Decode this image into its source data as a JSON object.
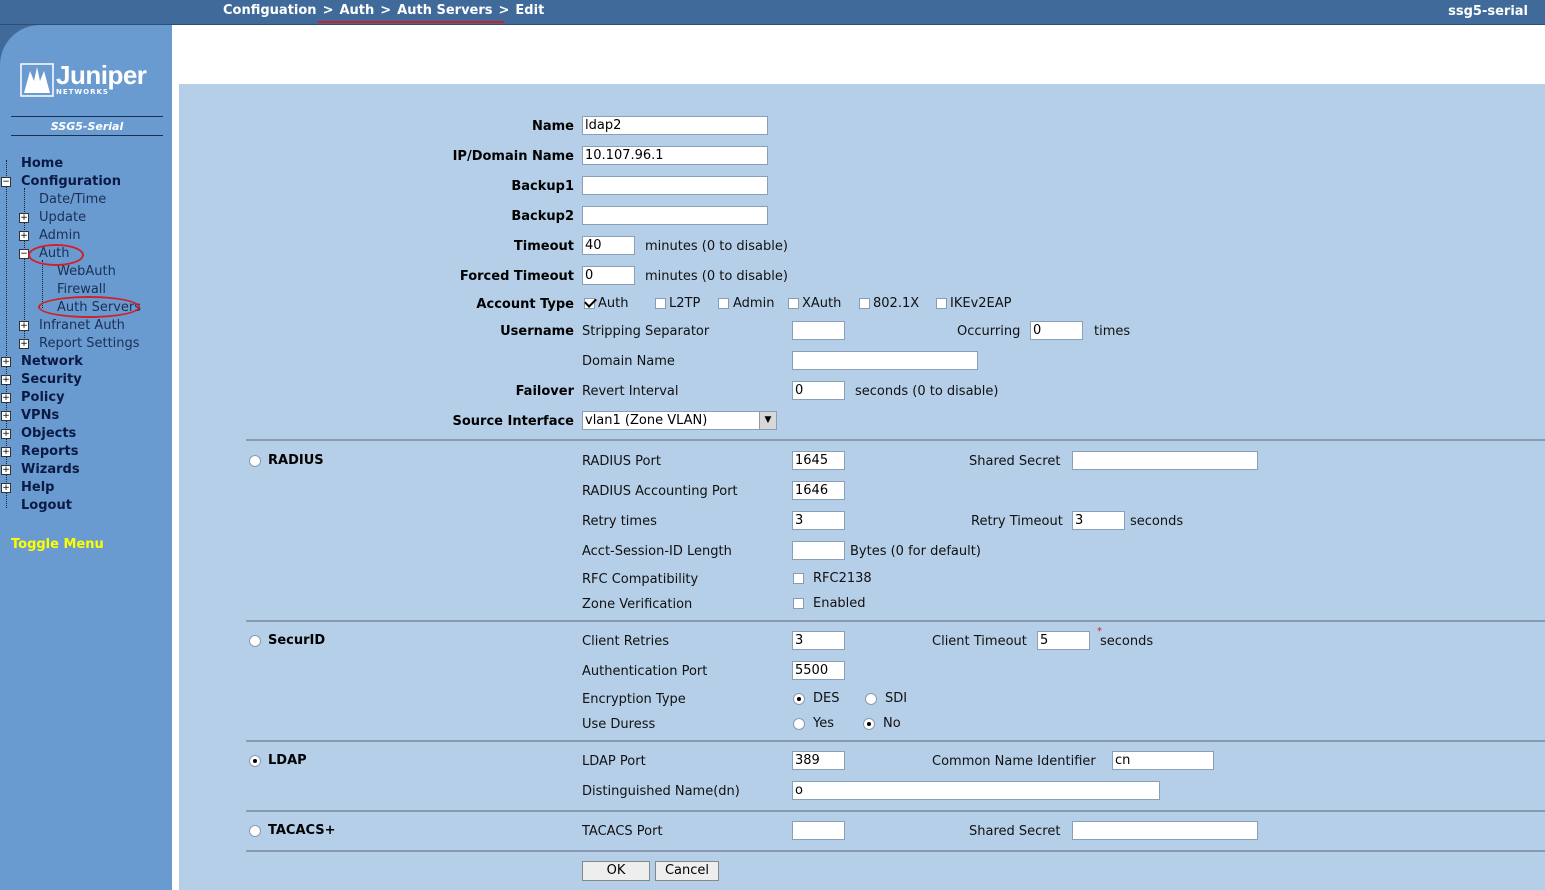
{
  "header": {
    "breadcrumb": [
      "Configuation",
      "Auth",
      "Auth Servers",
      "Edit"
    ],
    "breadcrumb_sep": ">",
    "device": "ssg5-serial"
  },
  "sidebar": {
    "logo": "Juniper",
    "logo_sub": "NETWORKS",
    "model": "SSG5-Serial",
    "items": [
      {
        "label": "Home",
        "level": 0,
        "expander": "none"
      },
      {
        "label": "Configuration",
        "level": 0,
        "expander": "minus"
      },
      {
        "label": "Date/Time",
        "level": 1,
        "expander": "none"
      },
      {
        "label": "Update",
        "level": 1,
        "expander": "plus"
      },
      {
        "label": "Admin",
        "level": 1,
        "expander": "plus"
      },
      {
        "label": "Auth",
        "level": 1,
        "expander": "minus"
      },
      {
        "label": "WebAuth",
        "level": 2,
        "expander": "none"
      },
      {
        "label": "Firewall",
        "level": 2,
        "expander": "none"
      },
      {
        "label": "Auth Servers",
        "level": 2,
        "expander": "none"
      },
      {
        "label": "Infranet Auth",
        "level": 1,
        "expander": "plus"
      },
      {
        "label": "Report Settings",
        "level": 1,
        "expander": "plus"
      },
      {
        "label": "Network",
        "level": 0,
        "expander": "plus"
      },
      {
        "label": "Security",
        "level": 0,
        "expander": "plus"
      },
      {
        "label": "Policy",
        "level": 0,
        "expander": "plus"
      },
      {
        "label": "VPNs",
        "level": 0,
        "expander": "plus"
      },
      {
        "label": "Objects",
        "level": 0,
        "expander": "plus"
      },
      {
        "label": "Reports",
        "level": 0,
        "expander": "plus"
      },
      {
        "label": "Wizards",
        "level": 0,
        "expander": "plus"
      },
      {
        "label": "Help",
        "level": 0,
        "expander": "plus"
      },
      {
        "label": "Logout",
        "level": 0,
        "expander": "none"
      }
    ],
    "toggle_menu": "Toggle Menu",
    "annotation_color": "#d02028"
  },
  "form": {
    "name": {
      "label": "Name",
      "value": "ldap2"
    },
    "ip_domain": {
      "label": "IP/Domain Name",
      "value": "10.107.96.1"
    },
    "backup1": {
      "label": "Backup1",
      "value": ""
    },
    "backup2": {
      "label": "Backup2",
      "value": ""
    },
    "timeout": {
      "label": "Timeout",
      "value": "40",
      "unit": "minutes (0 to disable)"
    },
    "forced_timeout": {
      "label": "Forced Timeout",
      "value": "0",
      "unit": "minutes (0 to disable)"
    },
    "account_type": {
      "label": "Account Type",
      "options": [
        {
          "label": "Auth",
          "checked": true
        },
        {
          "label": "L2TP",
          "checked": false
        },
        {
          "label": "Admin",
          "checked": false
        },
        {
          "label": "XAuth",
          "checked": false
        },
        {
          "label": "802.1X",
          "checked": false
        },
        {
          "label": "IKEv2EAP",
          "checked": false
        }
      ]
    },
    "username": {
      "label": "Username",
      "stripping_separator": {
        "label": "Stripping Separator",
        "value": ""
      },
      "occurring": {
        "label": "Occurring",
        "value": "0",
        "unit": "times"
      },
      "domain_name": {
        "label": "Domain Name",
        "value": ""
      }
    },
    "failover": {
      "label": "Failover",
      "revert_interval": {
        "label": "Revert Interval",
        "value": "0",
        "unit": "seconds (0 to disable)"
      }
    },
    "source_interface": {
      "label": "Source Interface",
      "value": "vlan1 (Zone VLAN)"
    },
    "radius": {
      "label": "RADIUS",
      "selected": false,
      "port": {
        "label": "RADIUS Port",
        "value": "1645"
      },
      "shared_secret": {
        "label": "Shared Secret",
        "value": ""
      },
      "accounting_port": {
        "label": "RADIUS Accounting Port",
        "value": "1646"
      },
      "retry_times": {
        "label": "Retry times",
        "value": "3"
      },
      "retry_timeout": {
        "label": "Retry Timeout",
        "value": "3",
        "unit": "seconds"
      },
      "acct_session": {
        "label": "Acct-Session-ID Length",
        "value": "",
        "unit": "Bytes (0 for default)"
      },
      "rfc": {
        "label": "RFC Compatibility",
        "option": "RFC2138",
        "checked": false
      },
      "zone_verification": {
        "label": "Zone Verification",
        "option": "Enabled",
        "checked": false
      }
    },
    "securid": {
      "label": "SecurID",
      "selected": false,
      "client_retries": {
        "label": "Client Retries",
        "value": "3"
      },
      "client_timeout": {
        "label": "Client Timeout",
        "value": "5",
        "unit": "seconds"
      },
      "auth_port": {
        "label": "Authentication Port",
        "value": "5500"
      },
      "encryption_type": {
        "label": "Encryption Type",
        "options": [
          "DES",
          "SDI"
        ],
        "selected": "DES"
      },
      "use_duress": {
        "label": "Use Duress",
        "options": [
          "Yes",
          "No"
        ],
        "selected": "No"
      }
    },
    "ldap": {
      "label": "LDAP",
      "selected": true,
      "port": {
        "label": "LDAP Port",
        "value": "389"
      },
      "cn_identifier": {
        "label": "Common Name Identifier",
        "value": "cn"
      },
      "dn": {
        "label": "Distinguished Name(dn)",
        "value": "o"
      }
    },
    "tacacs": {
      "label": "TACACS+",
      "selected": false,
      "port": {
        "label": "TACACS Port",
        "value": ""
      },
      "shared_secret": {
        "label": "Shared Secret",
        "value": ""
      }
    },
    "ok": "OK",
    "cancel": "Cancel"
  }
}
